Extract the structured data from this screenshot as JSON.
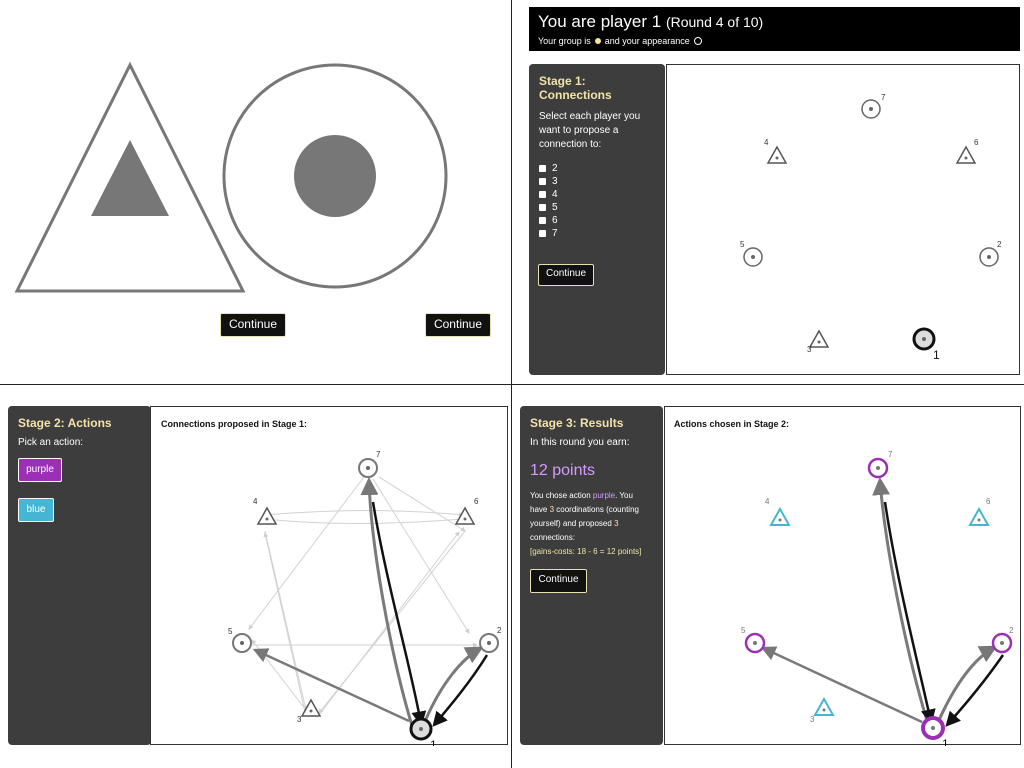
{
  "top_left": {
    "continue_left": "Continue",
    "continue_right": "Continue"
  },
  "top_right": {
    "header": {
      "title_prefix": "You are player ",
      "player_num": "1",
      "round": "(Round 4 of 10)",
      "group_line_prefix": "Your group is",
      "group_line_suffix": "and your appearance"
    },
    "stage": {
      "title_line1": "Stage 1:",
      "title_line2": "Connections",
      "instructions": "Select each player you want to propose a connection to:",
      "checkboxes": [
        "2",
        "3",
        "4",
        "5",
        "6",
        "7"
      ],
      "continue": "Continue"
    },
    "players": [
      {
        "id": "1",
        "shape": "circle",
        "self": true
      },
      {
        "id": "2",
        "shape": "circle"
      },
      {
        "id": "3",
        "shape": "triangle"
      },
      {
        "id": "4",
        "shape": "triangle"
      },
      {
        "id": "5",
        "shape": "circle"
      },
      {
        "id": "6",
        "shape": "triangle"
      },
      {
        "id": "7",
        "shape": "circle"
      }
    ]
  },
  "bottom_left": {
    "title": "Stage 2: Actions",
    "subtitle": "Pick an action:",
    "buttons": [
      "purple",
      "blue"
    ],
    "connections_title": "Connections proposed in Stage 1:",
    "labels": [
      "1",
      "2",
      "3",
      "4",
      "5",
      "6",
      "7"
    ]
  },
  "bottom_right": {
    "title": "Stage 3: Results",
    "earn_text": "In this round you earn:",
    "points": "12 points",
    "details": {
      "line1_a": "You chose action ",
      "line1_b": "purple",
      "line1_c": ". You have ",
      "line1_d": "3",
      "line1_e": " coordinations (counting yourself) and proposed ",
      "line1_f": "3",
      "line1_g": " connections:",
      "gains_costs": "[gains-costs: 18 - 6 = 12 points]"
    },
    "continue": "Continue",
    "actions_title": "Actions chosen in Stage 2:",
    "labels": [
      "1",
      "2",
      "3",
      "4",
      "5",
      "6",
      "7"
    ]
  },
  "colors": {
    "dark_panel": "#3d3d3d",
    "title_yellow": "#f1e3a9",
    "purple": "#9b2fb5",
    "purple_light": "#d39bff",
    "blue": "#44b6d3",
    "gray": "#7a7a7a"
  }
}
